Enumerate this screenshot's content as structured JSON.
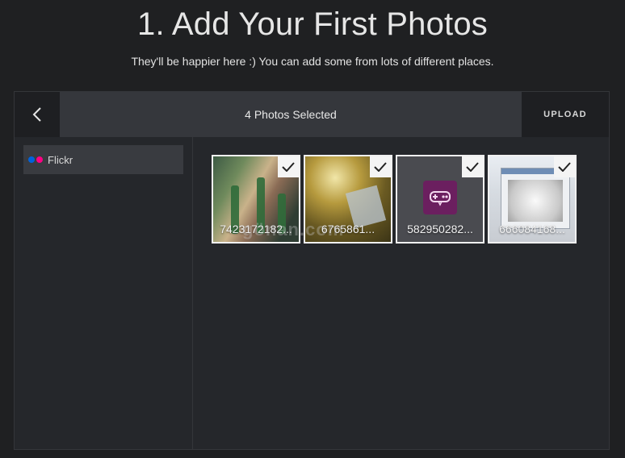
{
  "header": {
    "title": "1. Add Your First Photos",
    "subtitle": "They'll be happier here :) You can add some from lots of different places."
  },
  "picker": {
    "selected_label": "4 Photos Selected",
    "upload_label": "UPLOAD",
    "back_icon": "chevron-left-icon",
    "sources": [
      {
        "label": "Flickr",
        "icon": "flickr-icon",
        "dot_colors": [
          "#0063dc",
          "#ff0084"
        ],
        "active": true
      }
    ],
    "photos": [
      {
        "caption": "7423172182...",
        "selected": true
      },
      {
        "caption": "6765861...",
        "selected": true
      },
      {
        "caption": "582950282...",
        "selected": true
      },
      {
        "caption": "666084168...",
        "selected": true
      }
    ]
  },
  "watermark": "gönan.com",
  "colors": {
    "background": "#1f2022",
    "topbar": "#35373c",
    "flickr_blue": "#0063dc",
    "flickr_pink": "#ff0084",
    "app_icon": "#6b1f5f"
  }
}
